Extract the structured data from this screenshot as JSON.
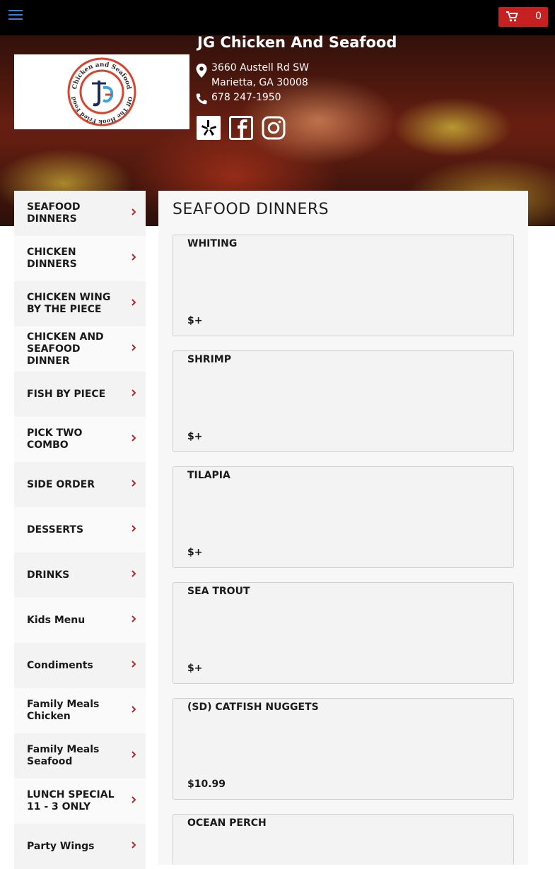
{
  "header": {
    "cart_count": "0",
    "colors": {
      "topbar": "#000000",
      "cart": "#c62020",
      "menu_icon": "#3d7fd6"
    }
  },
  "restaurant": {
    "name": "JG Chicken And Seafood",
    "address_line1": "3660 Austell Rd SW",
    "address_line2": "Marietta, GA 30008",
    "phone": "678 247-1950",
    "logo_text": {
      "top": "Chicken and Seafood",
      "bottom": "Off The Hook Fried Food",
      "initials": "JG"
    },
    "social": [
      "yelp-icon",
      "facebook-icon",
      "instagram-icon"
    ]
  },
  "sidebar": {
    "items": [
      {
        "label": "SEAFOOD DINNERS"
      },
      {
        "label": "CHICKEN DINNERS"
      },
      {
        "label": "CHICKEN WING BY THE PIECE"
      },
      {
        "label": "CHICKEN AND SEAFOOD DINNER"
      },
      {
        "label": "FISH BY PIECE"
      },
      {
        "label": "PICK TWO COMBO"
      },
      {
        "label": "SIDE ORDER"
      },
      {
        "label": "DESSERTS"
      },
      {
        "label": "DRINKS"
      },
      {
        "label": "Kids Menu"
      },
      {
        "label": "Condiments"
      },
      {
        "label": "Family Meals Chicken"
      },
      {
        "label": "Family Meals Seafood"
      },
      {
        "label": "LUNCH SPECIAL 11 - 3 ONLY"
      },
      {
        "label": "Party Wings"
      }
    ],
    "chevron_color": "#c62020"
  },
  "main": {
    "section_title": "SEAFOOD DINNERS",
    "items": [
      {
        "name": "WHITING",
        "price": "$+"
      },
      {
        "name": "SHRIMP",
        "price": "$+"
      },
      {
        "name": "TILAPIA",
        "price": "$+"
      },
      {
        "name": "SEA TROUT",
        "price": "$+"
      },
      {
        "name": "(SD) CATFISH NUGGETS",
        "price": "$10.99"
      },
      {
        "name": "OCEAN PERCH",
        "price": ""
      }
    ]
  }
}
